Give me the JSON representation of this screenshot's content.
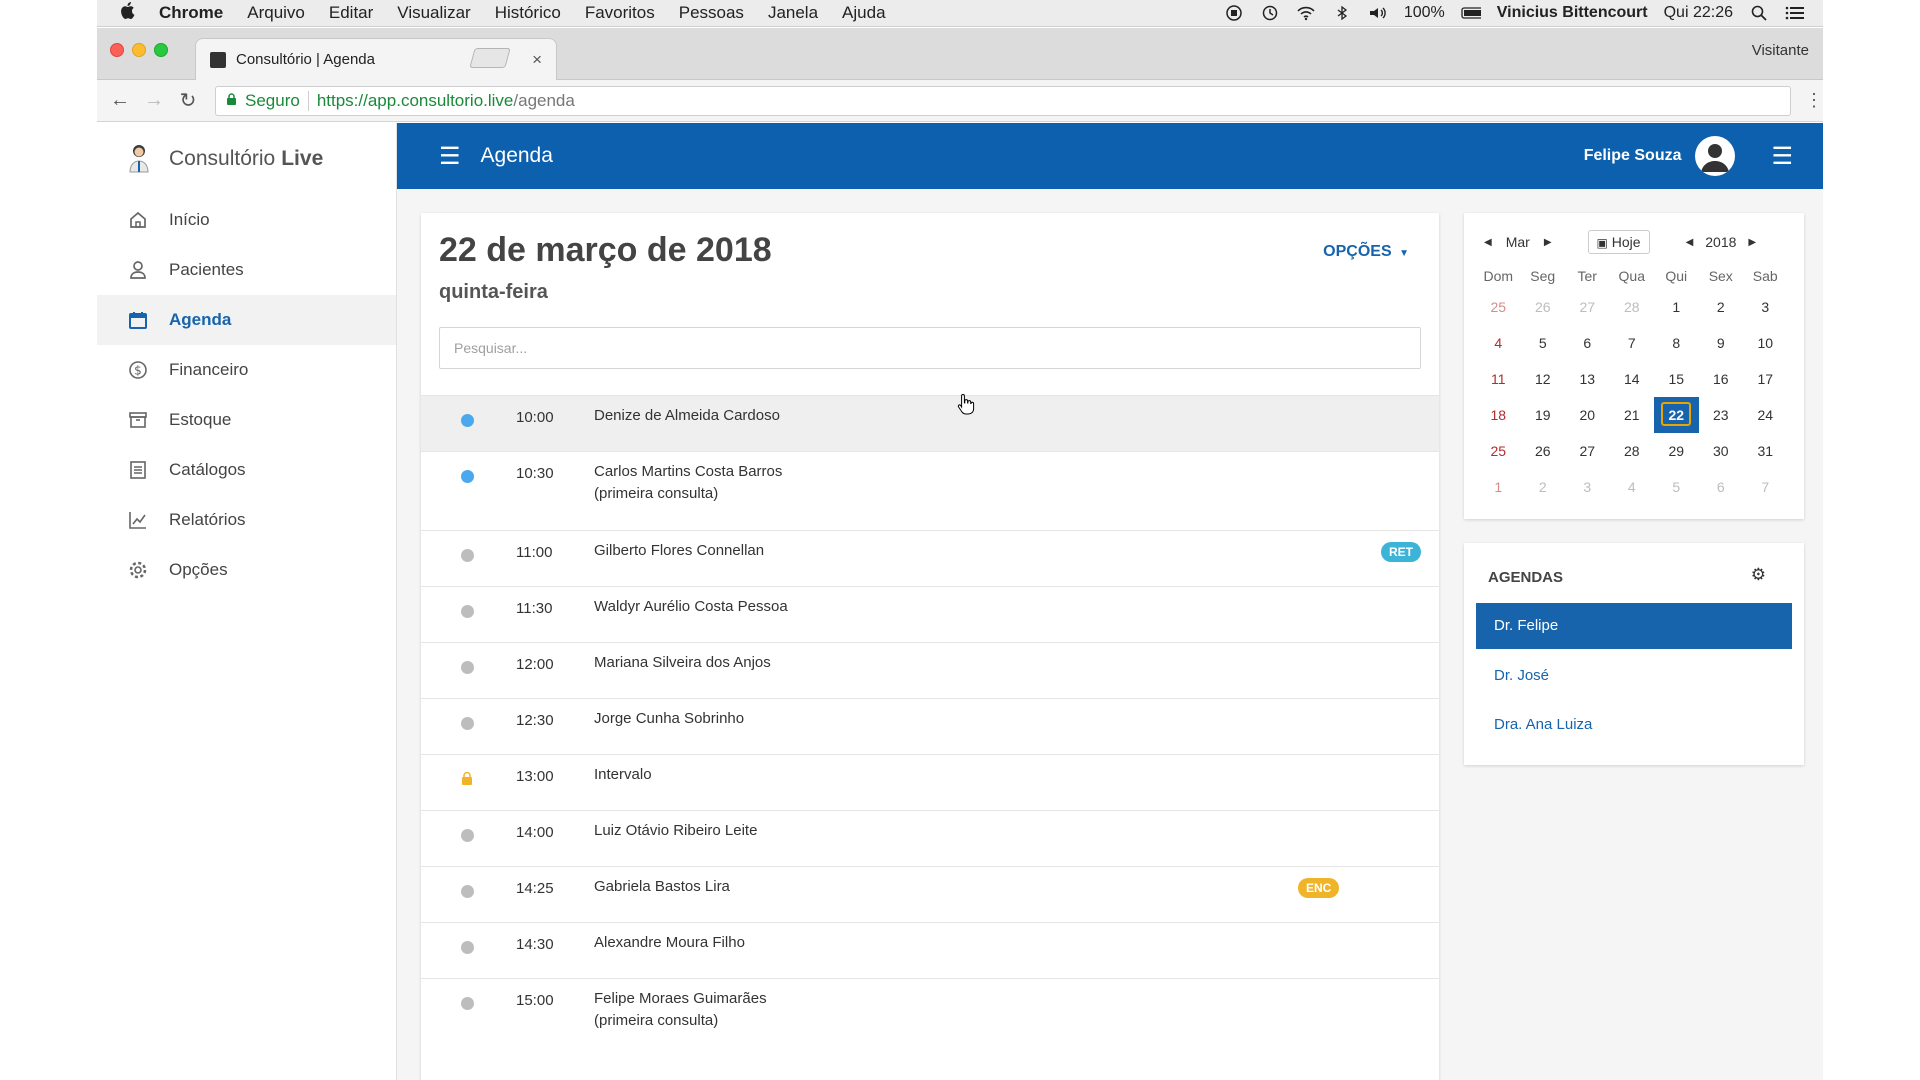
{
  "menubar": {
    "app": "Chrome",
    "items": [
      "Arquivo",
      "Editar",
      "Visualizar",
      "Histórico",
      "Favoritos",
      "Pessoas",
      "Janela",
      "Ajuda"
    ],
    "battery": "100%",
    "user": "Vinicius Bittencourt",
    "clock": "Qui 22:26"
  },
  "browser": {
    "tab_title": "Consultório | Agenda",
    "tab_close": "×",
    "guest": "Visitante",
    "secure_label": "Seguro",
    "url_host": "https://app.consultorio.live",
    "url_path": "/agenda"
  },
  "sidebar": {
    "brand_light": "Consultório",
    "brand_bold": "Live",
    "items": [
      {
        "label": "Início",
        "icon": "home-icon"
      },
      {
        "label": "Pacientes",
        "icon": "user-icon"
      },
      {
        "label": "Agenda",
        "icon": "calendar-icon"
      },
      {
        "label": "Financeiro",
        "icon": "dollar-icon"
      },
      {
        "label": "Estoque",
        "icon": "archive-icon"
      },
      {
        "label": "Catálogos",
        "icon": "list-icon"
      },
      {
        "label": "Relatórios",
        "icon": "chart-icon"
      },
      {
        "label": "Opções",
        "icon": "gear-icon"
      }
    ],
    "active_index": 2
  },
  "topbar": {
    "title": "Agenda",
    "user_name": "Felipe Souza"
  },
  "main": {
    "date_title": "22 de março de 2018",
    "weekday": "quinta-feira",
    "options_label": "OPÇÕES",
    "search_placeholder": "Pesquisar...",
    "appointments": [
      {
        "time": "10:00",
        "name": "Denize de Almeida Cardoso",
        "note": "",
        "status": "blue",
        "badge": ""
      },
      {
        "time": "10:30",
        "name": "Carlos Martins Costa Barros",
        "note": "(primeira consulta)",
        "status": "blue",
        "badge": ""
      },
      {
        "time": "11:00",
        "name": "Gilberto Flores Connellan",
        "note": "",
        "status": "gray",
        "badge": "RET"
      },
      {
        "time": "11:30",
        "name": "Waldyr Aurélio Costa Pessoa",
        "note": "",
        "status": "gray",
        "badge": ""
      },
      {
        "time": "12:00",
        "name": "Mariana Silveira dos Anjos",
        "note": "",
        "status": "gray",
        "badge": ""
      },
      {
        "time": "12:30",
        "name": "Jorge Cunha Sobrinho",
        "note": "",
        "status": "gray",
        "badge": ""
      },
      {
        "time": "13:00",
        "name": "Intervalo",
        "note": "",
        "status": "lock",
        "badge": ""
      },
      {
        "time": "14:00",
        "name": "Luiz Otávio Ribeiro Leite",
        "note": "",
        "status": "gray",
        "badge": ""
      },
      {
        "time": "14:25",
        "name": "Gabriela Bastos Lira",
        "note": "",
        "status": "gray",
        "badge": "ENC"
      },
      {
        "time": "14:30",
        "name": "Alexandre Moura Filho",
        "note": "",
        "status": "gray",
        "badge": ""
      },
      {
        "time": "15:00",
        "name": "Felipe Moraes Guimarães",
        "note": "(primeira consulta)",
        "status": "gray",
        "badge": ""
      }
    ]
  },
  "calendar": {
    "month": "Mar",
    "year": "2018",
    "today_label": "Hoje",
    "weekdays": [
      "Dom",
      "Seg",
      "Ter",
      "Qua",
      "Qui",
      "Sex",
      "Sab"
    ],
    "weeks": [
      [
        "25",
        "26",
        "27",
        "28",
        "1",
        "2",
        "3"
      ],
      [
        "4",
        "5",
        "6",
        "7",
        "8",
        "9",
        "10"
      ],
      [
        "11",
        "12",
        "13",
        "14",
        "15",
        "16",
        "17"
      ],
      [
        "18",
        "19",
        "20",
        "21",
        "22",
        "23",
        "24"
      ],
      [
        "25",
        "26",
        "27",
        "28",
        "29",
        "30",
        "31"
      ],
      [
        "1",
        "2",
        "3",
        "4",
        "5",
        "6",
        "7"
      ]
    ],
    "selected_day": "22"
  },
  "agendas": {
    "title": "AGENDAS",
    "items": [
      "Dr. Felipe",
      "Dr. José",
      "Dra. Ana Luiza"
    ],
    "active_index": 0
  },
  "colors": {
    "primary": "#1764ad",
    "topbar": "#0d60ae",
    "status_blue": "#4aa8ee",
    "status_gray": "#bdbdbd",
    "badge_ret": "#3bb4d8",
    "badge_enc": "#f0b429",
    "lock": "#f0b429",
    "sunday": "#b42b2b"
  }
}
